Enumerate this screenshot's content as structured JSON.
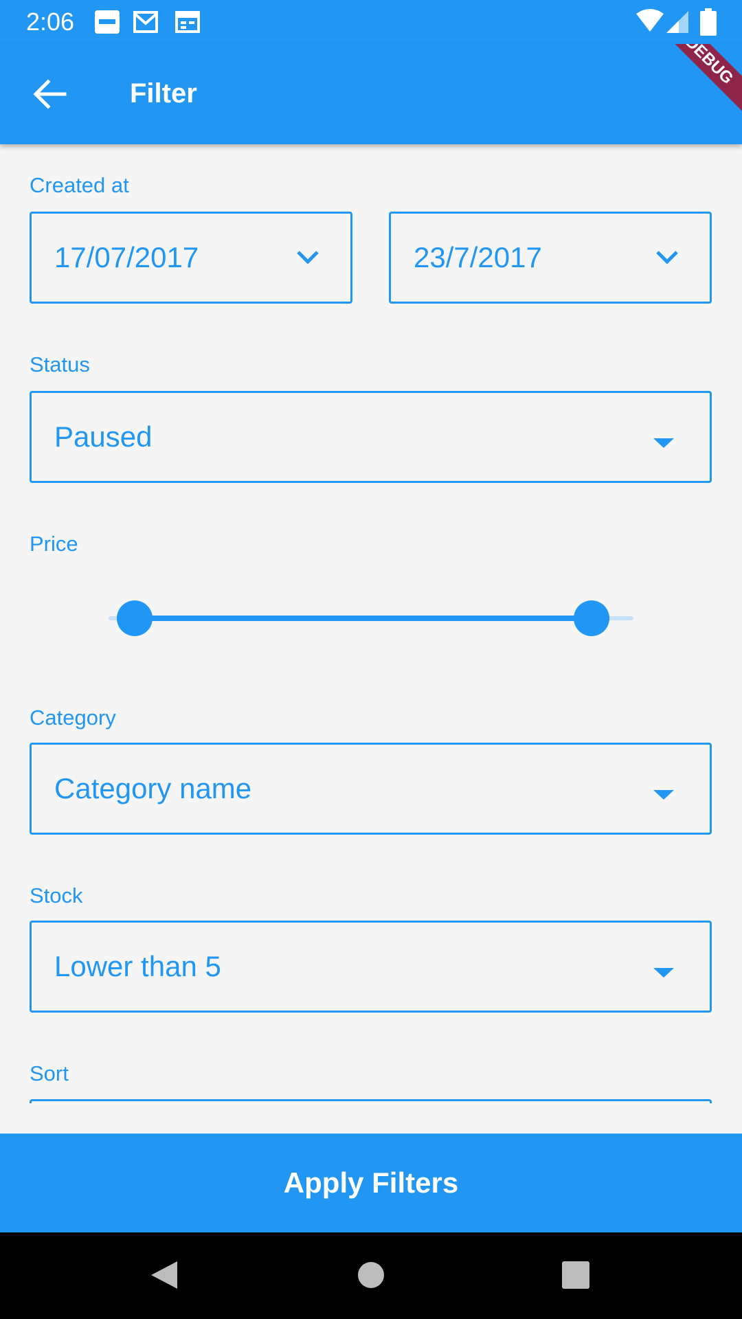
{
  "status_bar": {
    "time": "2:06",
    "notification_icons": [
      "souq-app-icon",
      "gmail-icon",
      "calendar-icon"
    ],
    "system_icons": [
      "wifi-icon",
      "signal-icon",
      "battery-icon"
    ]
  },
  "app_bar": {
    "title": "Filter",
    "debug_banner": "DEBUG"
  },
  "filters": {
    "created_at": {
      "label": "Created at",
      "from": "17/07/2017",
      "to": "23/7/2017"
    },
    "status": {
      "label": "Status",
      "value": "Paused"
    },
    "price": {
      "label": "Price",
      "range_start_fraction": 0.05,
      "range_end_fraction": 0.92
    },
    "category": {
      "label": "Category",
      "value": "Category name"
    },
    "stock": {
      "label": "Stock",
      "value": "Lower than 5"
    },
    "sort": {
      "label": "Sort"
    }
  },
  "apply_button": "Apply Filters",
  "colors": {
    "primary": "#2196f3",
    "background": "#f5f5f5",
    "debug_banner": "#8e2447"
  }
}
